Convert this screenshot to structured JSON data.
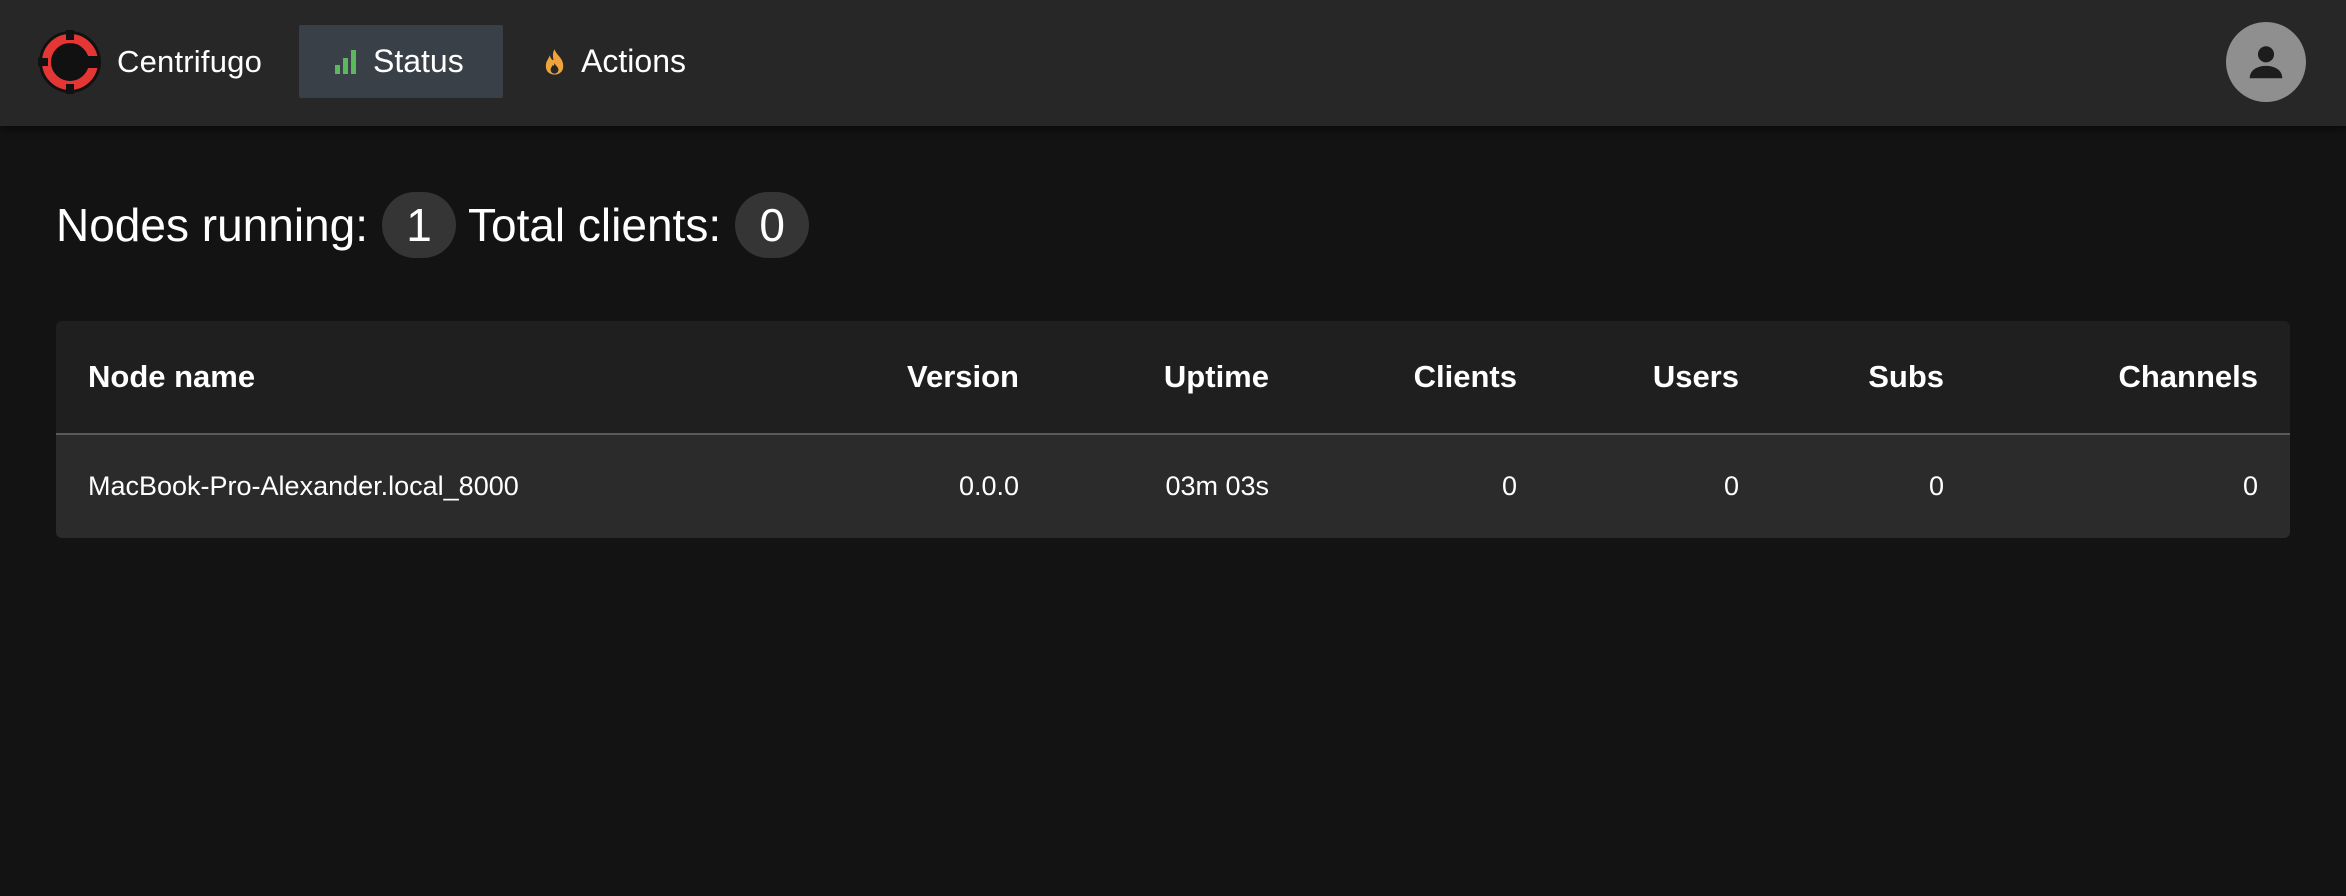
{
  "app": {
    "name": "Centrifugo",
    "logo_icon": "centrifugo-logo-icon",
    "accent": "#e43735"
  },
  "nav": {
    "items": [
      {
        "label": "Status",
        "icon": "signal-bars-icon",
        "active": true,
        "icon_color": "#5cb85c"
      },
      {
        "label": "Actions",
        "icon": "fire-icon",
        "active": false,
        "icon_color": "#f0a33a"
      }
    ]
  },
  "user_menu": {
    "icon": "account-icon"
  },
  "summary": {
    "nodes_label": "Nodes running:",
    "nodes_value": "1",
    "clients_label": "Total clients:",
    "clients_value": "0"
  },
  "table": {
    "columns": [
      "Node name",
      "Version",
      "Uptime",
      "Clients",
      "Users",
      "Subs",
      "Channels"
    ],
    "rows": [
      {
        "node_name": "MacBook-Pro-Alexander.local_8000",
        "version": "0.0.0",
        "uptime": "03m 03s",
        "clients": "0",
        "users": "0",
        "subs": "0",
        "channels": "0"
      }
    ]
  }
}
